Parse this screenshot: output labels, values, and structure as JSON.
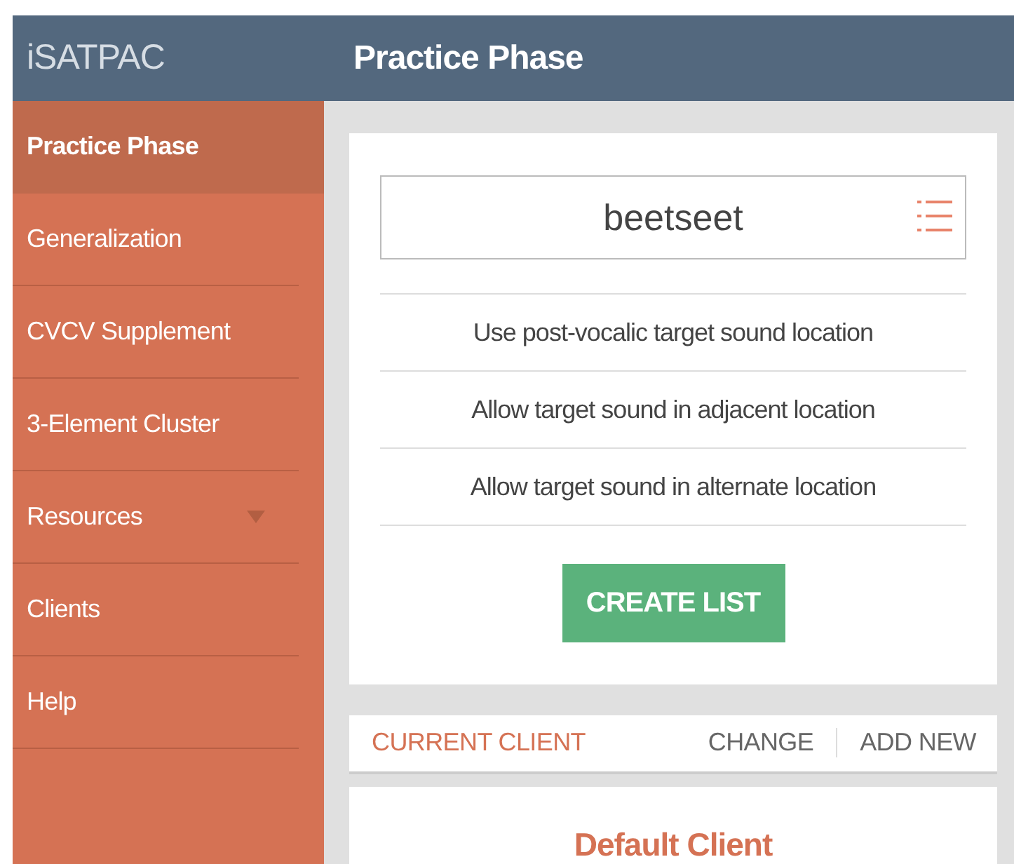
{
  "header": {
    "app_name": "iSATPAC",
    "page_title": "Practice Phase"
  },
  "sidebar": {
    "items": [
      {
        "label": "Practice Phase",
        "selected": true,
        "kind": "link"
      },
      {
        "label": "Generalization",
        "selected": false,
        "kind": "link"
      },
      {
        "label": "CVCV Supplement",
        "selected": false,
        "kind": "link"
      },
      {
        "label": "3-Element Cluster",
        "selected": false,
        "kind": "link"
      },
      {
        "label": "Resources",
        "selected": false,
        "kind": "submenu"
      },
      {
        "label": "Clients",
        "selected": false,
        "kind": "link"
      },
      {
        "label": "Help",
        "selected": false,
        "kind": "link"
      }
    ]
  },
  "list_card": {
    "word_field": {
      "value": "beetseet"
    },
    "options": [
      "Use post-vocalic target sound location",
      "Allow target sound in adjacent location",
      "Allow target sound in alternate location"
    ],
    "button": "CREATE LIST"
  },
  "client_bar": {
    "title": "CURRENT CLIENT",
    "actions": [
      "CHANGE",
      "ADD NEW"
    ]
  },
  "client_card": {
    "name": "Default Client"
  }
}
